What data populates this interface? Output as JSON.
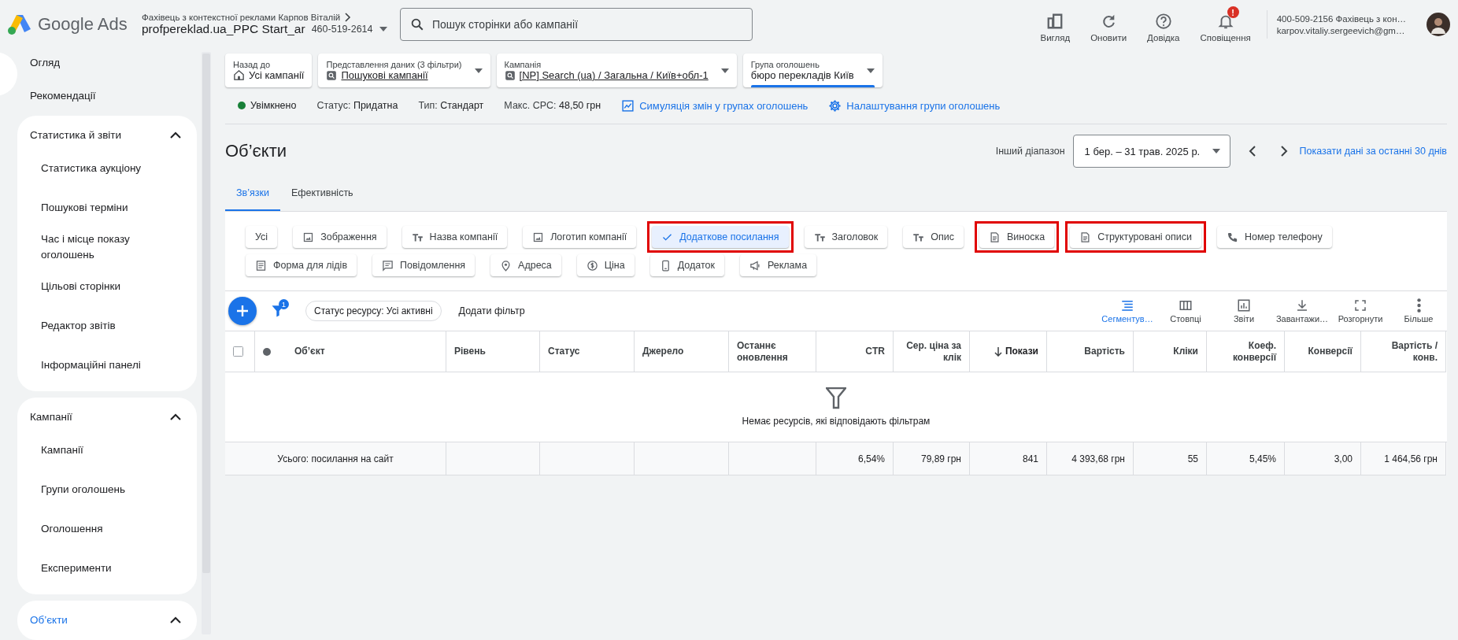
{
  "header": {
    "logo_text": "Google Ads",
    "account_owner": "Фахівець з контекстної реклами Карпов Віталій",
    "account_name": "profpereklad.ua_PPC Start_ar",
    "account_id": "460-519-2614",
    "search": {
      "placeholder": "Пошук сторінки або кампанії"
    },
    "actions": [
      {
        "label": "Вигляд",
        "kind": "view"
      },
      {
        "label": "Оновити",
        "kind": "refresh"
      },
      {
        "label": "Довідка",
        "kind": "help"
      },
      {
        "label": "Сповіщення",
        "kind": "bell",
        "badge": "!"
      }
    ],
    "user": {
      "line1": "400-509-2156 Фахівець з кон…",
      "line2": "karpov.vitaliy.sergeevich@gm…"
    }
  },
  "sidebar": {
    "items": [
      {
        "kind": "item",
        "label": "Огляд"
      },
      {
        "kind": "item",
        "label": "Рекомендації"
      },
      {
        "kind": "section",
        "label": "Статистика й звіти",
        "expanded": true,
        "selected": false,
        "children": [
          "Статистика аукціону",
          "Пошукові терміни",
          "Час і місце показу оголошень",
          "Цільові сторінки",
          "Редактор звітів",
          "Інформаційні панелі"
        ]
      },
      {
        "kind": "section",
        "label": "Кампанії",
        "expanded": true,
        "selected": false,
        "children": [
          "Кампанії",
          "Групи оголошень",
          "Оголошення",
          "Експерименти"
        ]
      },
      {
        "kind": "section",
        "label": "Об’єкти",
        "expanded": true,
        "selected": true
      }
    ]
  },
  "breadcrumbs": [
    {
      "label": "Назад до",
      "value": "Усі кампанії",
      "kind": "home"
    },
    {
      "label": "Представлення даних (3 фільтри)",
      "value": "Пошукові кампанії",
      "kind": "link"
    },
    {
      "label": "Кампанія",
      "value": "[NP] Search (ua) / Загальна / Київ+обл-1",
      "kind": "link"
    },
    {
      "label": "Група оголошень",
      "value": "бюро перекладів Київ",
      "kind": "current"
    }
  ],
  "status_line": {
    "state": "Увімкнено",
    "enabled": true,
    "status_label": "Статус:",
    "status_value": "Придатна",
    "type_label": "Тип:",
    "type_value": "Стандарт",
    "cpc_label": "Макс. CPC:",
    "cpc_value": "48,50 грн",
    "links": [
      {
        "label": "Симуляція змін у групах оголошень",
        "kind": "chart"
      },
      {
        "label": "Налаштування групи оголошень",
        "kind": "gear"
      }
    ]
  },
  "page": {
    "title": "Об’єкти",
    "range_label": "Інший діапазон",
    "range": "1 бер. – 31 трав. 2025 р.",
    "last_days_link": "Показати дані за останні 30 днів"
  },
  "tabs": [
    {
      "label": "Зв’язки",
      "selected": true
    },
    {
      "label": "Ефективність",
      "selected": false
    }
  ],
  "chips": [
    {
      "label": "Усі",
      "kind": "all",
      "selected": false,
      "highlighted": false
    },
    {
      "label": "Зображення",
      "kind": "image",
      "selected": false,
      "highlighted": false
    },
    {
      "label": "Назва компанії",
      "kind": "text",
      "selected": false,
      "highlighted": false
    },
    {
      "label": "Логотип компанії",
      "kind": "image",
      "selected": false,
      "highlighted": false
    },
    {
      "label": "Додаткове посилання",
      "kind": "link",
      "selected": true,
      "highlighted": true
    },
    {
      "label": "Заголовок",
      "kind": "text",
      "selected": false,
      "highlighted": false
    },
    {
      "label": "Опис",
      "kind": "text",
      "selected": false,
      "highlighted": false
    },
    {
      "label": "Виноска",
      "kind": "document",
      "selected": false,
      "highlighted": true
    },
    {
      "label": "Структуровані описи",
      "kind": "document",
      "selected": false,
      "highlighted": true
    },
    {
      "label": "Номер телефону",
      "kind": "phone",
      "selected": false,
      "highlighted": false
    },
    {
      "label": "Форма для лідів",
      "kind": "form",
      "selected": false,
      "highlighted": false
    },
    {
      "label": "Повідомлення",
      "kind": "message",
      "selected": false,
      "highlighted": false
    },
    {
      "label": "Адреса",
      "kind": "location",
      "selected": false,
      "highlighted": false
    },
    {
      "label": "Ціна",
      "kind": "price",
      "selected": false,
      "highlighted": false
    },
    {
      "label": "Додаток",
      "kind": "app",
      "selected": false,
      "highlighted": false
    },
    {
      "label": "Реклама",
      "kind": "promotion",
      "selected": false,
      "highlighted": false
    }
  ],
  "toolbar": {
    "filter_count": "1",
    "filter_chip": "Статус ресурсу: Усі активні",
    "add_filter": "Додати фільтр",
    "tools": [
      {
        "label": "Сегментув…",
        "kind": "segment",
        "selected": true
      },
      {
        "label": "Стовпці",
        "kind": "columns",
        "selected": false
      },
      {
        "label": "Звіти",
        "kind": "reports",
        "selected": false
      },
      {
        "label": "Завантажи…",
        "kind": "download",
        "selected": false
      },
      {
        "label": "Розгорнути",
        "kind": "expand",
        "selected": false
      },
      {
        "label": "Більше",
        "kind": "more",
        "selected": false
      }
    ]
  },
  "table": {
    "select_all": {
      "checked": false
    },
    "columns": [
      {
        "label": "Об’єкт",
        "kind": "text",
        "sorted": false
      },
      {
        "label": "Рівень",
        "kind": "text",
        "sorted": false
      },
      {
        "label": "Статус",
        "kind": "text",
        "sorted": false
      },
      {
        "label": "Джерело",
        "kind": "text",
        "sorted": false
      },
      {
        "label": "Останнє оновлення",
        "kind": "text",
        "sorted": false
      },
      {
        "label": "CTR",
        "kind": "number",
        "sorted": false,
        "total": "6,54%"
      },
      {
        "label": "Сер. ціна за клік",
        "kind": "number",
        "sorted": false,
        "total": "79,89 грн"
      },
      {
        "label": "Покази",
        "kind": "number",
        "sorted": true,
        "total": "841"
      },
      {
        "label": "Вартість",
        "kind": "number",
        "sorted": false,
        "total": "4 393,68 грн"
      },
      {
        "label": "Кліки",
        "kind": "number",
        "sorted": false,
        "total": "55"
      },
      {
        "label": "Коеф. конверсії",
        "kind": "number",
        "sorted": false,
        "total": "5,45%"
      },
      {
        "label": "Конверсії",
        "kind": "number",
        "sorted": false,
        "total": "3,00"
      },
      {
        "label": "Вартість / конв.",
        "kind": "number",
        "sorted": false,
        "total": "1 464,56 грн"
      }
    ],
    "empty_message": "Немає ресурсів, які відповідають фільтрам",
    "total_label": "Усього: посилання на сайт"
  }
}
